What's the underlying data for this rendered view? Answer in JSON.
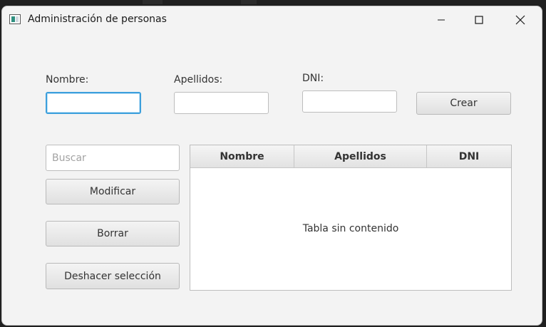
{
  "window": {
    "title": "Administración de personas"
  },
  "form": {
    "nombre_label": "Nombre:",
    "apellidos_label": "Apellidos:",
    "dni_label": "DNI:",
    "nombre_value": "",
    "apellidos_value": "",
    "dni_value": "",
    "crear_label": "Crear"
  },
  "sidebar": {
    "search_placeholder": "Buscar",
    "modificar_label": "Modificar",
    "borrar_label": "Borrar",
    "deshacer_label": "Deshacer selección"
  },
  "table": {
    "columns": [
      "Nombre",
      "Apellidos",
      "DNI"
    ],
    "rows": [],
    "empty_text": "Tabla sin contenido"
  },
  "icons": {
    "app": "app-window-icon",
    "minimize": "minimize-icon",
    "maximize": "maximize-icon",
    "close": "close-icon"
  },
  "colors": {
    "focus": "#3c9fdc",
    "window_bg": "#f3f3f3"
  }
}
